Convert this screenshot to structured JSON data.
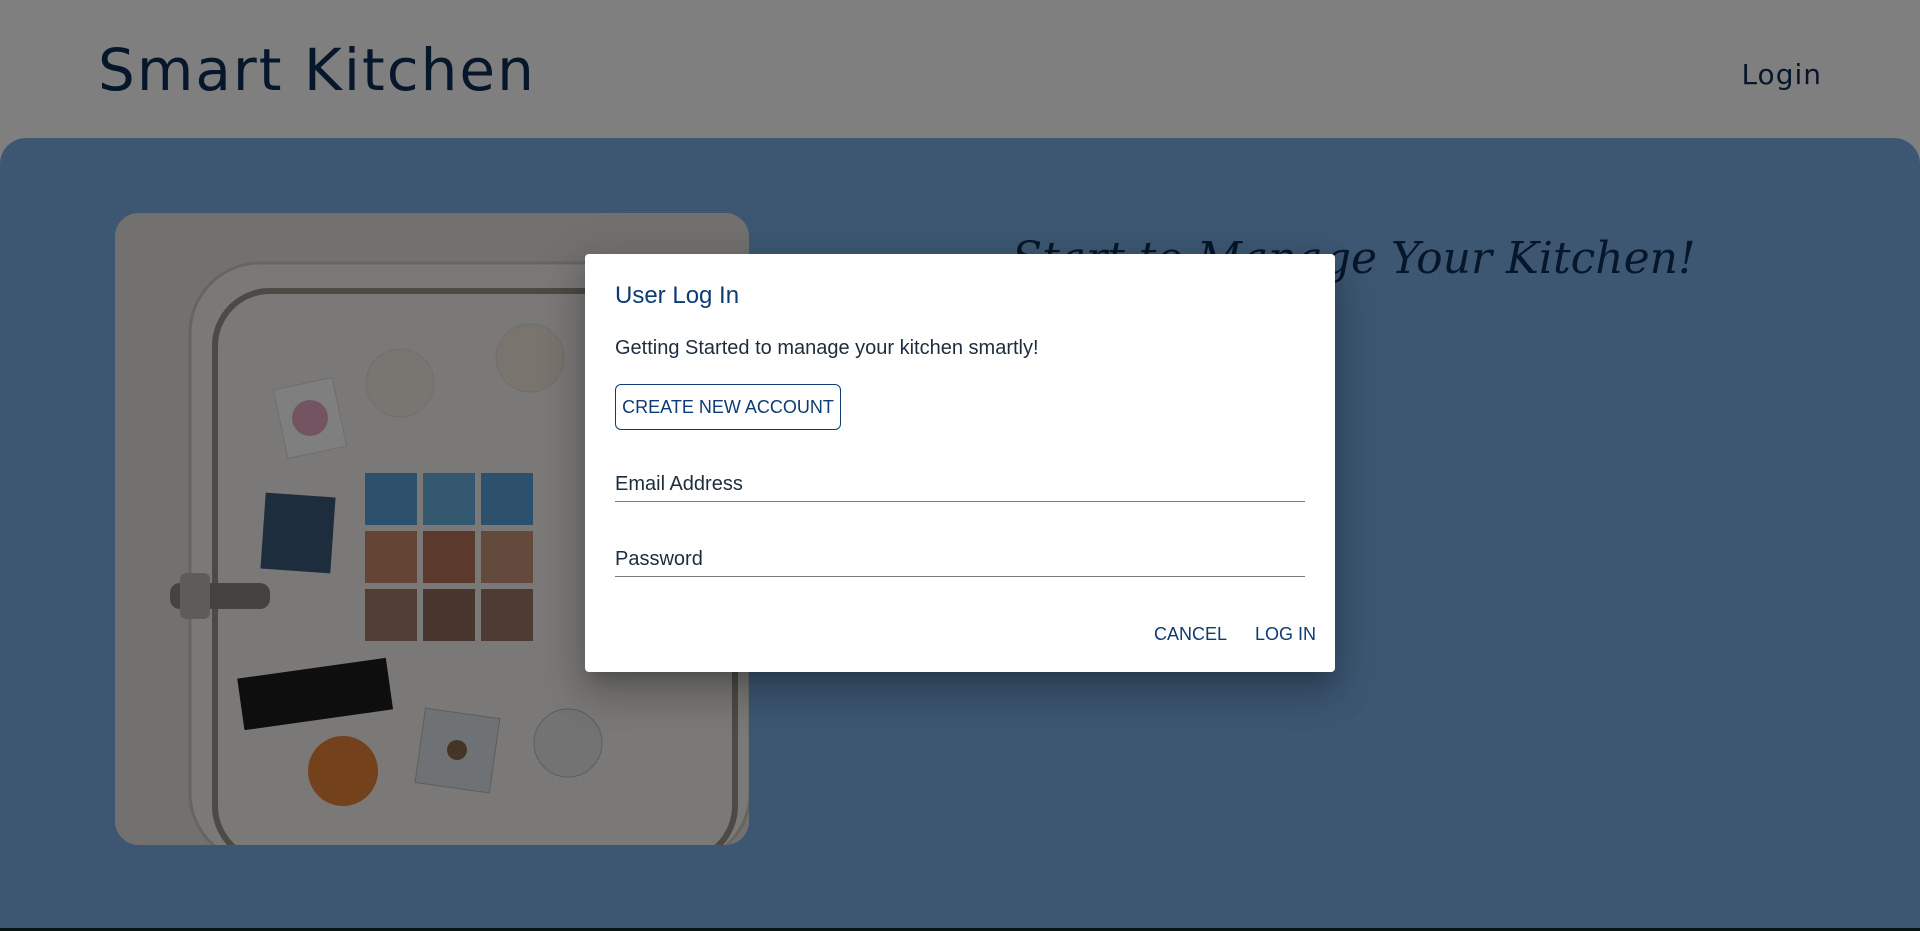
{
  "header": {
    "brand": "Smart Kitchen",
    "login_link": "Login"
  },
  "hero": {
    "tagline": "Start to Manage Your Kitchen!",
    "image_icon": "fridge-photo"
  },
  "dialog": {
    "title": "User Log In",
    "description": "Getting Started to manage your kitchen smartly!",
    "create_account_label": "CREATE NEW ACCOUNT",
    "email_placeholder": "Email Address",
    "password_placeholder": "Password",
    "cancel_label": "CANCEL",
    "login_label": "LOG IN"
  },
  "colors": {
    "primary": "#0d3b73",
    "hero_bg": "#7aaee6",
    "backdrop": "rgba(0,0,0,0.5)"
  }
}
